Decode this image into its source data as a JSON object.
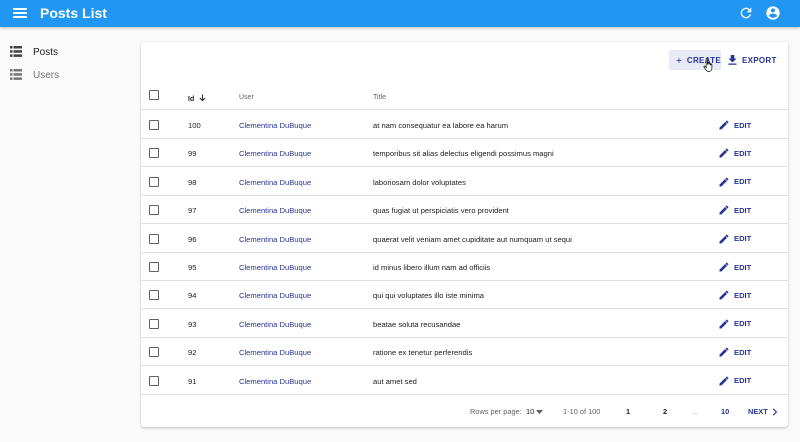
{
  "appbar": {
    "title": "Posts List",
    "menu_icon": "menu-icon",
    "refresh_icon": "refresh-icon",
    "account_icon": "account-circle-icon",
    "color": "#2196f3"
  },
  "sidebar": {
    "items": [
      {
        "label": "Posts",
        "icon": "list-icon",
        "active": true
      },
      {
        "label": "Users",
        "icon": "list-icon",
        "active": false
      }
    ]
  },
  "toolbar": {
    "create_label": "CREATE",
    "export_label": "EXPORT"
  },
  "table": {
    "headers": {
      "id": "Id",
      "user": "User",
      "title": "Title"
    },
    "sort": {
      "field": "Id",
      "direction": "desc"
    },
    "edit_label": "EDIT",
    "rows": [
      {
        "id": "100",
        "user": "Clementina DuBuque",
        "title": "at nam consequatur ea labore ea harum"
      },
      {
        "id": "99",
        "user": "Clementina DuBuque",
        "title": "temporibus sit alias delectus eligendi possimus magni"
      },
      {
        "id": "98",
        "user": "Clementina DuBuque",
        "title": "laboriosam dolor voluptates"
      },
      {
        "id": "97",
        "user": "Clementina DuBuque",
        "title": "quas fugiat ut perspiciatis vero provident"
      },
      {
        "id": "96",
        "user": "Clementina DuBuque",
        "title": "quaerat velit veniam amet cupiditate aut numquam ut sequi"
      },
      {
        "id": "95",
        "user": "Clementina DuBuque",
        "title": "id minus libero illum nam ad officiis"
      },
      {
        "id": "94",
        "user": "Clementina DuBuque",
        "title": "qui qui voluptates illo iste minima"
      },
      {
        "id": "93",
        "user": "Clementina DuBuque",
        "title": "beatae soluta recusandae"
      },
      {
        "id": "92",
        "user": "Clementina DuBuque",
        "title": "ratione ex tenetur perferendis"
      },
      {
        "id": "91",
        "user": "Clementina DuBuque",
        "title": "aut amet sed"
      }
    ]
  },
  "pagination": {
    "rows_per_page_label": "Rows per page:",
    "rows_per_page": "10",
    "range": "1-10 of 100",
    "page1": "1",
    "page2": "2",
    "ellipsis": "...",
    "page_last": "10",
    "next_label": "NEXT"
  },
  "colors": {
    "accent": "#283593",
    "highlight": "#e8eaf6"
  }
}
